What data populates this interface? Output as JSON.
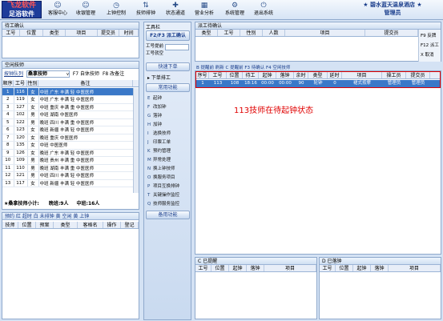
{
  "topbar": {
    "logo_line1": "飞龙软件",
    "logo_line2": "足浴软件",
    "buttons": [
      {
        "label": "客服中心",
        "icon": "smiley-icon"
      },
      {
        "label": "收银管理",
        "icon": "smiley-icon"
      },
      {
        "label": "上钟控制",
        "icon": "clock-icon"
      },
      {
        "label": "技师排钟",
        "icon": "sort-icon"
      },
      {
        "label": "状态通道",
        "icon": "plus-icon"
      },
      {
        "label": "营业分析",
        "icon": "chart-icon"
      },
      {
        "label": "系统管理",
        "icon": "gear-icon"
      },
      {
        "label": "退出系统",
        "icon": "exit-icon"
      }
    ],
    "shop_name": "★ 碧水蓝天温泉酒店 ★",
    "role": "管理员"
  },
  "waiting_panel": {
    "title": "待工确认",
    "columns": [
      "工号",
      "位置",
      "类型",
      "项目",
      "提交员",
      "时间"
    ]
  },
  "tech_panel": {
    "title": "空闲技师",
    "sort_label": "按钟队列",
    "filter_value": "桑拿技师",
    "f7": "F7 自休技师",
    "f8": "F8 改备注",
    "columns": [
      "顺序",
      "工号",
      "性别",
      "备注"
    ],
    "rows": [
      [
        "1",
        "116",
        "女",
        "中班 广东 丰满 轻 中医医师"
      ],
      [
        "2",
        "119",
        "女",
        "中班 广东 丰满 轻 中医医师"
      ],
      [
        "3",
        "127",
        "女",
        "中班 重庆 丰满 重 中医医师"
      ],
      [
        "4",
        "102",
        "男",
        "中班 湖南 中医医师"
      ],
      [
        "5",
        "122",
        "男",
        "晚班 四川 丰满 重 中医医师"
      ],
      [
        "6",
        "123",
        "女",
        "晚班 新疆 丰满 轻 中医医师"
      ],
      [
        "7",
        "120",
        "女",
        "晚班 重庆 中医医师"
      ],
      [
        "8",
        "135",
        "女",
        "中班 中医医师"
      ],
      [
        "9",
        "126",
        "女",
        "晚班 广东 丰满 轻 中医医师"
      ],
      [
        "10",
        "109",
        "男",
        "晚班 贵州 丰满 重 中医医师"
      ],
      [
        "11",
        "110",
        "男",
        "晚班 湖南 丰满 重 中医医师"
      ],
      [
        "12",
        "121",
        "男",
        "中班 四川 丰满 轻 中医医师"
      ],
      [
        "13",
        "117",
        "女",
        "中班 新疆 丰满 轻 中医医师"
      ]
    ],
    "summary": "★桑拿技师小计:",
    "summary_late": "晚班:9人",
    "summary_mid": "中班:16人"
  },
  "booking_panel": {
    "title": "预约 红 超时 白 未排钟 黄 空闲 黄 上钟",
    "columns": [
      "技师",
      "位置",
      "预案",
      "类型",
      "客格名",
      "操作",
      "登记"
    ]
  },
  "toolbar": {
    "title": "工具栏",
    "confirm_btn": "F2/F3 派工确认",
    "worker_id_label": "工号提前",
    "queue_label": "工号就空",
    "quick_order": "快速下单",
    "next_order": "下单排工",
    "common": "常用功能",
    "menu": [
      "起钟",
      "改加钟",
      "落钟",
      "加钟",
      "选换技师",
      "印票工单",
      "预约管理",
      "异常处理",
      "换上钟技师",
      "换服务项目",
      "项目互换排钟",
      "关键操作监控",
      "技师服务监控"
    ],
    "menu_keys": [
      "E",
      "F",
      "G",
      "H",
      "I",
      "J",
      "K",
      "M",
      "N",
      "O",
      "P",
      "T",
      "Q"
    ],
    "spare": "备用功能"
  },
  "dispatch_panel": {
    "title": "派工待确认",
    "columns": [
      "类型",
      "工号",
      "性别",
      "人数",
      "项目",
      "提交员"
    ],
    "side": [
      "F9 反牌",
      "F12 派工",
      "X 取消"
    ]
  },
  "hints": {
    "text": "B 提醒前  刷新 C 提醒前  F3 待确认  F4 空闲技师"
  },
  "main_table": {
    "columns": [
      "序号",
      "工号",
      "位置",
      "待工",
      "起钟",
      "落钟",
      "余时",
      "类型",
      "延时",
      "项目",
      "操工员",
      "提交员"
    ],
    "row": [
      "1",
      "113",
      "108",
      "18:16",
      "00:00",
      "00:00",
      "90",
      "轮钟",
      "0",
      "裙式按摩",
      "管理员",
      "管理员"
    ],
    "annotation": "113技师在待起钟状态"
  },
  "bottom_left": {
    "title": "C 已提醒",
    "columns": [
      "工号",
      "位置",
      "起钟",
      "落钟",
      "项目"
    ]
  },
  "bottom_right": {
    "title": "D 已落钟",
    "columns": [
      "工号",
      "位置",
      "起钟",
      "落钟",
      "项目"
    ]
  }
}
